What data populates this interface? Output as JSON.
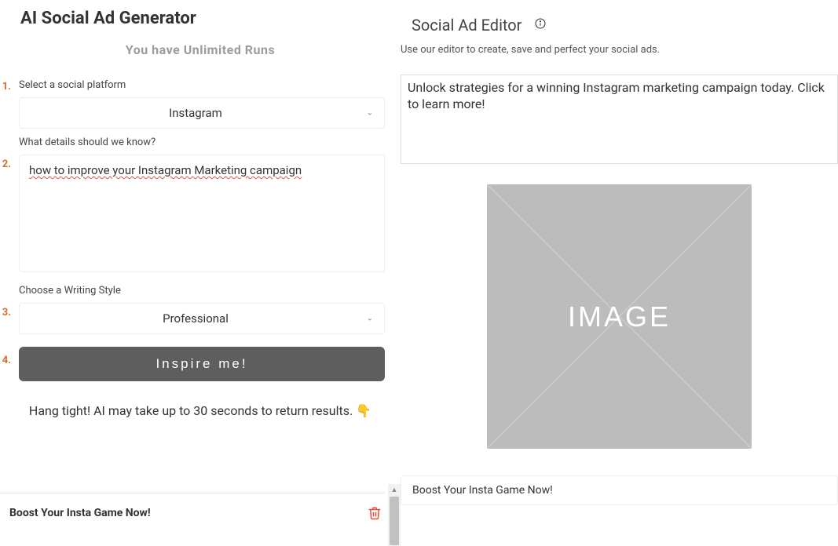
{
  "left": {
    "title": "AI Social Ad Generator",
    "runs_text": "You have Unlimited Runs",
    "step1": {
      "label": "Select a social platform",
      "value": "Instagram"
    },
    "step2": {
      "label": "What details should we know?",
      "value": "how to improve your Instagram Marketing campaign"
    },
    "step3": {
      "label": "Choose a Writing Style",
      "value": "Professional"
    },
    "inspire_label": "Inspire me!",
    "hang_tight": "Hang tight! AI may take up to 30 seconds to return results.",
    "result_title": "Boost Your Insta Game Now!"
  },
  "right": {
    "title": "Social Ad Editor",
    "subtitle": "Use our editor to create, save and perfect your social ads.",
    "ad_text": "Unlock strategies for a winning Instagram marketing campaign today. Click to learn more!",
    "image_label": "IMAGE",
    "cta_text": "Boost Your Insta Game Now!"
  }
}
